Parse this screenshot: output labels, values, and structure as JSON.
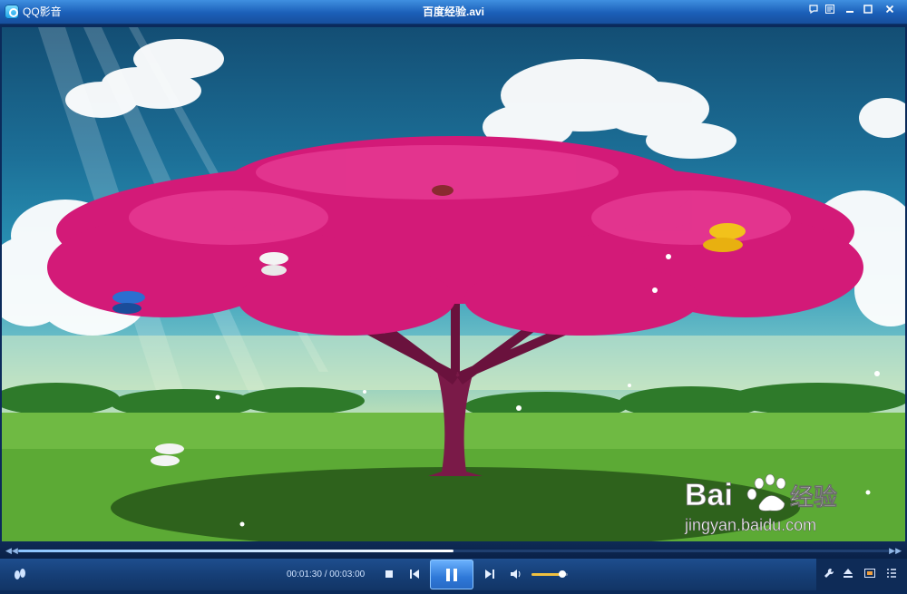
{
  "window": {
    "app_name": "QQ影音",
    "title": "百度经验.avi"
  },
  "titlebar_buttons": [
    "chat-icon",
    "menu-icon",
    "minimize-icon",
    "maximize-icon",
    "close-icon"
  ],
  "player": {
    "time_display": "00:01:30 / 00:03:00",
    "seek_progress": 0.5,
    "volume_level": 0.85
  },
  "watermark": {
    "brand_text": "Bai",
    "brand_cn": "经验",
    "domain": "jingyan.baidu.com"
  },
  "colors": {
    "titlebar": "#1b5fb8",
    "controlbar": "#163f77",
    "accent": "#2e78d8",
    "volume": "#f0c040"
  }
}
